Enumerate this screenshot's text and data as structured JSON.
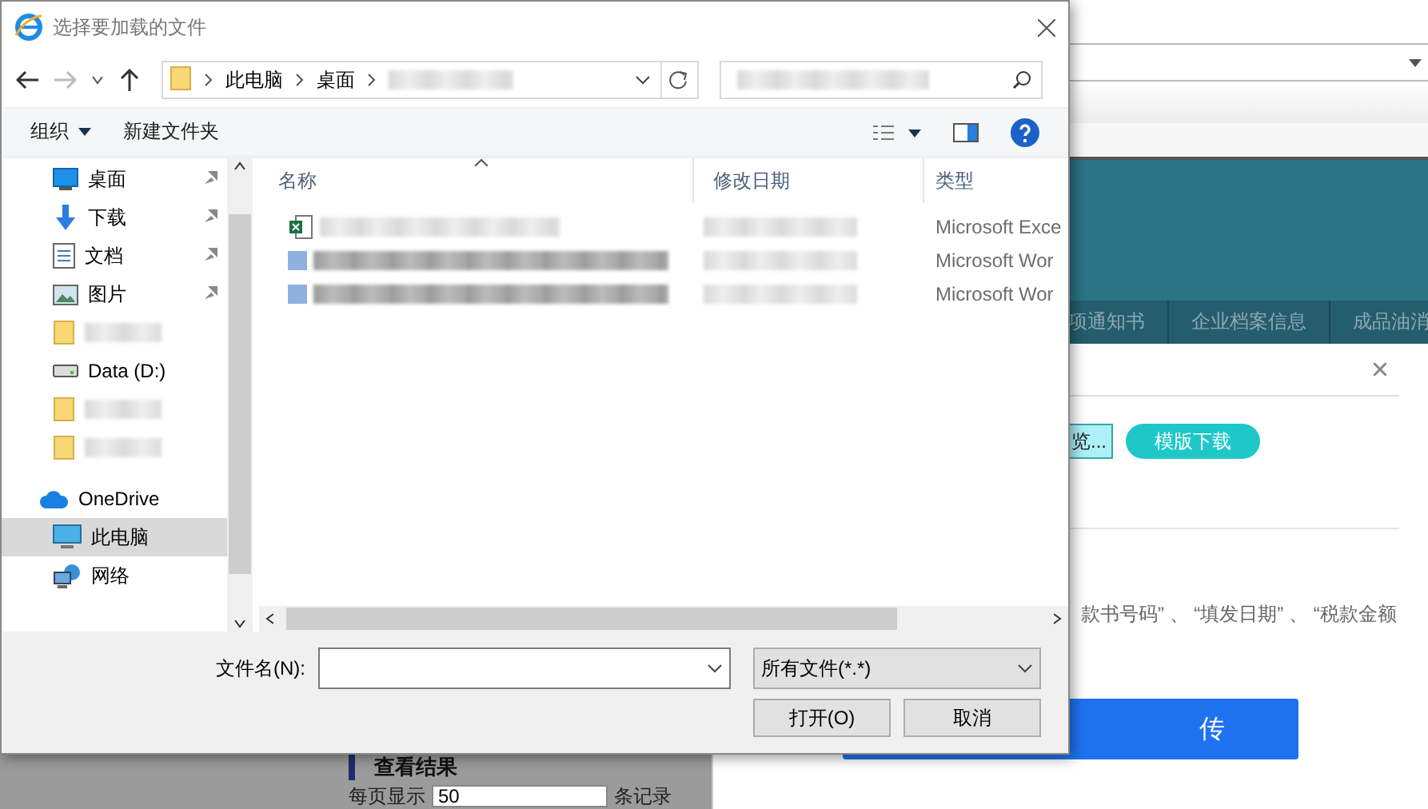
{
  "dialog": {
    "title": "选择要加载的文件",
    "forward_enabled": false,
    "breadcrumb": [
      "此电脑",
      "桌面"
    ],
    "toolbar": {
      "organize": "组织",
      "new_folder": "新建文件夹"
    },
    "nav_items": [
      {
        "kind": "desktop",
        "label": "桌面",
        "pinned": true,
        "selected": false
      },
      {
        "kind": "download",
        "label": "下载",
        "pinned": true,
        "selected": false
      },
      {
        "kind": "document",
        "label": "文档",
        "pinned": true,
        "selected": false
      },
      {
        "kind": "picture",
        "label": "图片",
        "pinned": true,
        "selected": false
      },
      {
        "kind": "folder",
        "pinned": false,
        "selected": false
      },
      {
        "kind": "drive",
        "label": "Data (D:)",
        "pinned": false,
        "selected": false
      },
      {
        "kind": "folder",
        "pinned": false,
        "selected": false
      },
      {
        "kind": "folder",
        "pinned": false,
        "selected": false
      },
      {
        "kind": "cloud",
        "label": "OneDrive",
        "pinned": false,
        "selected": false
      },
      {
        "kind": "computer",
        "label": "此电脑",
        "pinned": false,
        "selected": true
      },
      {
        "kind": "network",
        "label": "网络",
        "pinned": false,
        "selected": false
      }
    ],
    "columns": [
      "名称",
      "修改日期",
      "类型"
    ],
    "files": [
      {
        "kind": "excel",
        "type": "Microsoft Exce"
      },
      {
        "kind": "word",
        "type": "Microsoft Wor"
      },
      {
        "kind": "word",
        "type": "Microsoft Wor"
      }
    ],
    "filename_label": "文件名(N):",
    "filter": "所有文件(*.*)",
    "buttons": [
      "打开(O)",
      "取消"
    ]
  },
  "page": {
    "tabs": [
      "项通知书",
      "企业档案信息",
      "成品油消"
    ],
    "modal": {
      "browse": "览...",
      "template_button": "模版下载",
      "note": "款书号码” 、 “填发日期” 、 “税款金额",
      "submit": "传"
    },
    "results_heading": "查看结果",
    "page_size": {
      "label": "每页显示",
      "value": "50",
      "suffix": "条记录"
    }
  }
}
